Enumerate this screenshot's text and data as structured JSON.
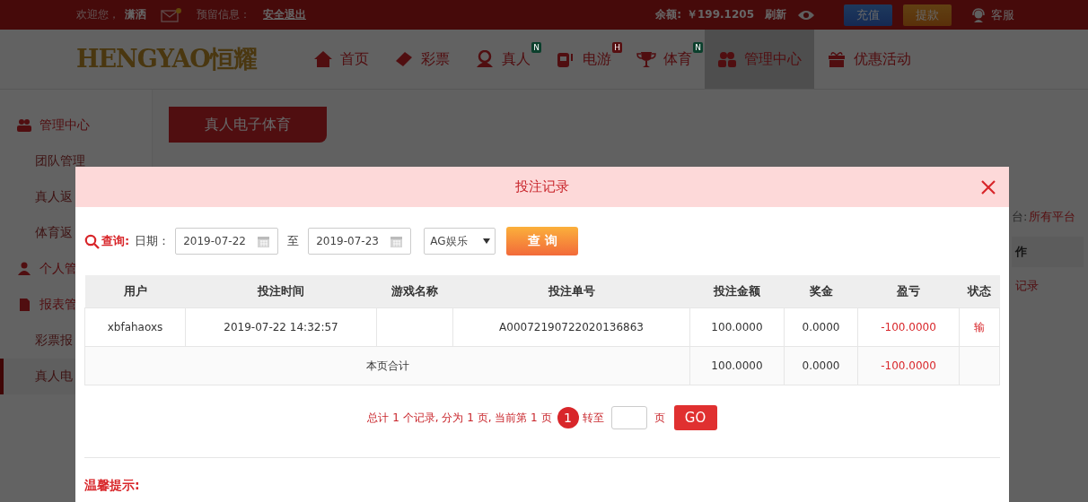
{
  "top_bar": {
    "welcome": "欢迎您，",
    "username": "潇洒",
    "mail_unread": true,
    "reserved_label": "预留信息：",
    "logout": "安全退出",
    "balance_label": "余额:",
    "balance": "￥199.1205",
    "refresh": "刷新",
    "deposit": "充值",
    "withdraw": "提款",
    "service": "客服"
  },
  "nav": {
    "logo": "HENGYAO恒耀",
    "items": [
      {
        "label": "首页",
        "kind": "home",
        "selected": false
      },
      {
        "label": "彩票",
        "kind": "ticket",
        "selected": false
      },
      {
        "label": "真人",
        "kind": "dealer",
        "selected": false,
        "badge": {
          "text": "N",
          "color": "#0b3f2c"
        }
      },
      {
        "label": "电游",
        "kind": "slot",
        "selected": false,
        "badge": {
          "text": "H",
          "color": "#560f11"
        }
      },
      {
        "label": "体育",
        "kind": "trophy",
        "selected": false,
        "badge": {
          "text": "N",
          "color": "#0b3f2c"
        }
      },
      {
        "label": "管理中心",
        "kind": "people",
        "selected": true
      },
      {
        "label": "优惠活动",
        "kind": "gift",
        "selected": false
      }
    ]
  },
  "sidebar": {
    "items": [
      {
        "label": "管理中心",
        "kind": "team",
        "selected": false
      },
      {
        "label": "团队管理",
        "kind": "link",
        "selected": false
      },
      {
        "label": "真人返",
        "kind": "link",
        "selected": false
      },
      {
        "label": "体育返",
        "kind": "link",
        "selected": false
      },
      {
        "label": "个人管",
        "kind": "profile",
        "selected": false
      },
      {
        "label": "报表管",
        "kind": "report",
        "selected": false
      },
      {
        "label": "彩票报",
        "kind": "link",
        "selected": false
      },
      {
        "label": "真人电",
        "kind": "link",
        "selected": true
      }
    ]
  },
  "page": {
    "tab": "真人电子体育",
    "platform_label": "台:",
    "platform_value": "所有平台",
    "column": "作",
    "link": "记录"
  },
  "modal": {
    "title": "投注记录",
    "query": {
      "label": "查询:",
      "date_label": "日期：",
      "from": "2019-07-22",
      "to_label": "至",
      "to": "2019-07-23",
      "platform": "AG娱乐",
      "button": "查 询"
    },
    "table": {
      "columns": [
        {
          "label": "用户",
          "kind": "text"
        },
        {
          "label": "投注时间",
          "kind": "text"
        },
        {
          "label": "游戏名称",
          "kind": "text"
        },
        {
          "label": "投注单号",
          "kind": "text"
        },
        {
          "label": "投注金额",
          "kind": "money"
        },
        {
          "label": "奖金",
          "kind": "money"
        },
        {
          "label": "盈亏",
          "kind": "profit"
        },
        {
          "label": "状态",
          "kind": "status"
        }
      ],
      "rows": [
        {
          "cells": [
            "xbfahaoxs",
            "2019-07-22 14:32:57",
            "",
            "A00072190722020136863",
            "100.0000",
            "0.0000",
            "-100.0000",
            "输"
          ]
        }
      ],
      "total": {
        "label": "本页合计",
        "cells": [
          "100.0000",
          "0.0000",
          "-100.0000",
          ""
        ]
      }
    },
    "pagination": {
      "summary": "总计 1 个记录, 分为 1 页, 当前第 1 页",
      "pages": [
        {
          "label": "1",
          "selected": true
        }
      ],
      "goto_label": "转至",
      "page_unit": "页",
      "go": "GO"
    },
    "tip_title": "温馨提示:"
  }
}
